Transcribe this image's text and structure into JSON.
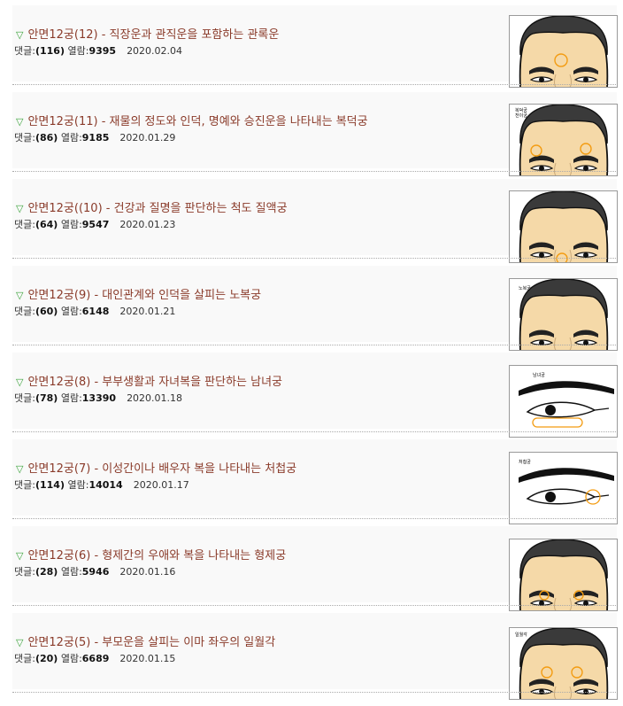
{
  "labels": {
    "comments": "댓글:",
    "views": "열람:"
  },
  "posts": [
    {
      "title": "안면12궁(12) - 직장운과 관직운을 포함하는 관록운",
      "comments": "(116)",
      "views": "9395",
      "date": "2020.02.04",
      "thumb": "face",
      "caption": "",
      "caption2": ""
    },
    {
      "title": "안면12궁(11) - 재물의 정도와 인덕, 명예와 승진운을 나타내는 복덕궁",
      "comments": "(86)",
      "views": "9185",
      "date": "2020.01.29",
      "thumb": "face",
      "caption": "복덕궁",
      "caption2": "천이궁"
    },
    {
      "title": "안면12궁((10) - 건강과 질명을 판단하는 척도 질액궁",
      "comments": "(64)",
      "views": "9547",
      "date": "2020.01.23",
      "thumb": "face",
      "caption": "",
      "caption2": ""
    },
    {
      "title": "안면12궁(9) - 대인관계와 인덕을 살피는 노복궁",
      "comments": "(60)",
      "views": "6148",
      "date": "2020.01.21",
      "thumb": "face",
      "caption": "노복궁",
      "caption2": ""
    },
    {
      "title": "안면12궁(8) - 부부생활과 자녀복을 판단하는 남녀궁",
      "comments": "(78)",
      "views": "13390",
      "date": "2020.01.18",
      "thumb": "eye",
      "caption": "남녀궁",
      "caption2": ""
    },
    {
      "title": "안면12궁(7) - 이성간이나 배우자 복을 나타내는 처첩궁",
      "comments": "(114)",
      "views": "14014",
      "date": "2020.01.17",
      "thumb": "eye",
      "caption": "처첩궁",
      "caption2": ""
    },
    {
      "title": "안면12궁(6) - 형제간의 우애와 복을 나타내는 형제궁",
      "comments": "(28)",
      "views": "5946",
      "date": "2020.01.16",
      "thumb": "face",
      "caption": "",
      "caption2": ""
    },
    {
      "title": "안면12궁(5) - 부모운을 살피는 이마 좌우의 일월각",
      "comments": "(20)",
      "views": "6689",
      "date": "2020.01.15",
      "thumb": "face",
      "caption": "일월각",
      "caption2": ""
    }
  ]
}
